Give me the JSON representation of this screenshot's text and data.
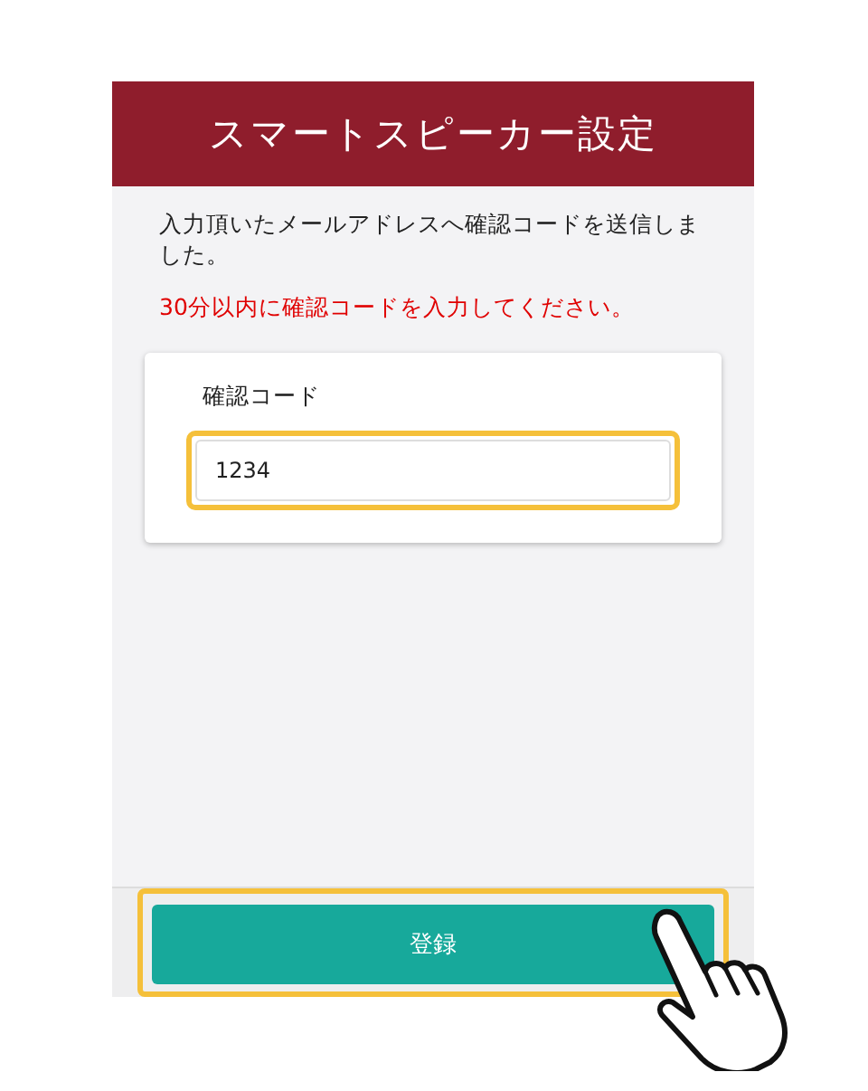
{
  "header": {
    "title": "スマートスピーカー設定"
  },
  "message": "入力頂いたメールアドレスへ確認コードを送信しました。",
  "notice": "30分以内に確認コードを入力してください。",
  "form": {
    "label": "確認コード",
    "value": "1234",
    "highlighted": true
  },
  "footer": {
    "button": "登録",
    "highlighted": true
  }
}
